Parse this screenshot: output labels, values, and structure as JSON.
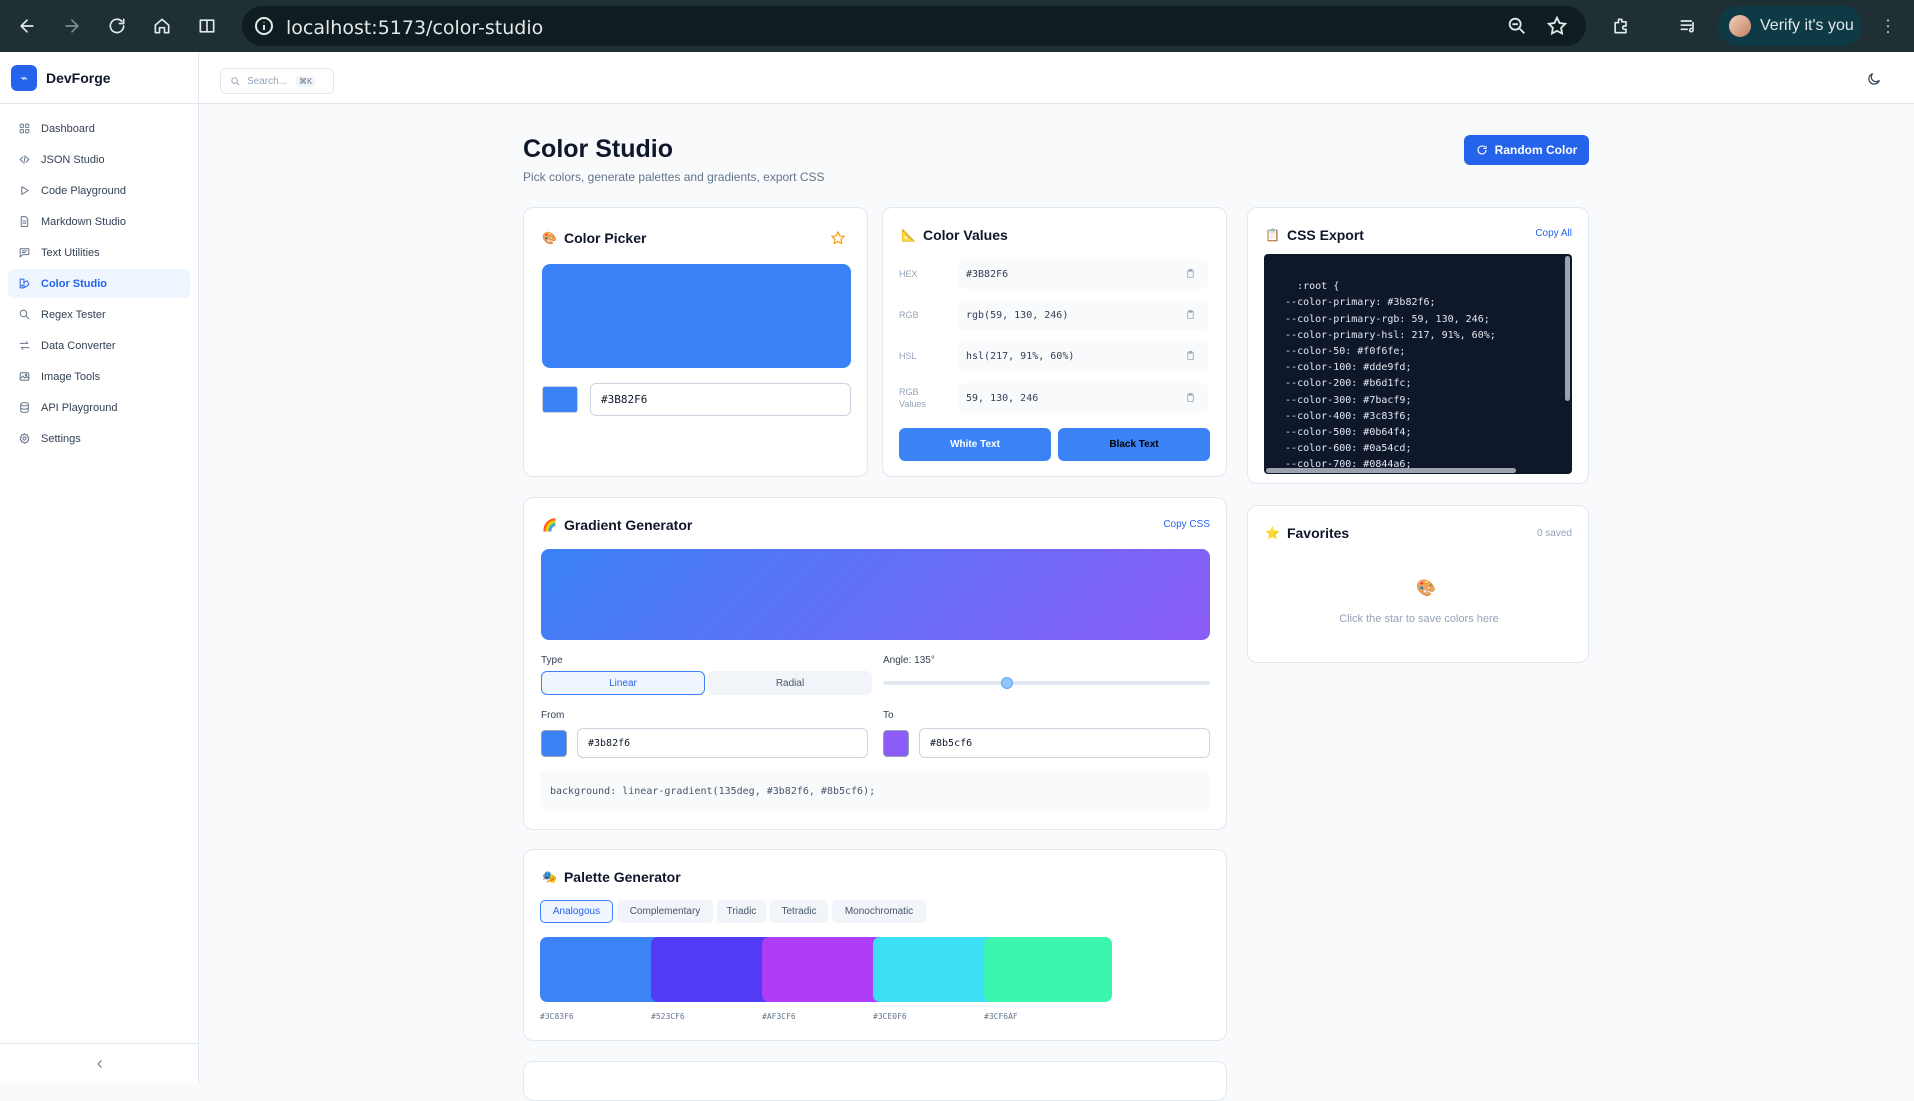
{
  "browser": {
    "url": "localhost:5173/color-studio",
    "profile_label": "Verify it's you"
  },
  "app": {
    "name": "DevForge",
    "search_placeholder": "Search...",
    "search_shortcut": "⌘K"
  },
  "sidebar": {
    "items": [
      {
        "label": "Dashboard",
        "icon": "grid-icon"
      },
      {
        "label": "JSON Studio",
        "icon": "code-icon"
      },
      {
        "label": "Code Playground",
        "icon": "play-icon"
      },
      {
        "label": "Markdown Studio",
        "icon": "document-icon"
      },
      {
        "label": "Text Utilities",
        "icon": "message-icon"
      },
      {
        "label": "Color Studio",
        "icon": "palette-icon",
        "active": true
      },
      {
        "label": "Regex Tester",
        "icon": "search-icon"
      },
      {
        "label": "Data Converter",
        "icon": "swap-icon"
      },
      {
        "label": "Image Tools",
        "icon": "image-icon"
      },
      {
        "label": "API Playground",
        "icon": "database-icon"
      },
      {
        "label": "Settings",
        "icon": "gear-icon"
      }
    ]
  },
  "header": {
    "title": "Color Studio",
    "subtitle": "Pick colors, generate palettes and gradients, export CSS",
    "random_button": "Random Color"
  },
  "picker": {
    "title": "Color Picker",
    "emoji": "🎨",
    "hex_value": "#3B82F6",
    "color": "#3b82f6"
  },
  "values": {
    "title": "Color Values",
    "emoji": "📐",
    "rows": [
      {
        "label": "HEX",
        "value": "#3B82F6"
      },
      {
        "label": "RGB",
        "value": "rgb(59, 130, 246)"
      },
      {
        "label": "HSL",
        "value": "hsl(217, 91%, 60%)"
      },
      {
        "label": "RGB Values",
        "value": "59, 130, 246"
      }
    ],
    "white_text_button": "White Text",
    "black_text_button": "Black Text"
  },
  "css_export": {
    "title": "CSS Export",
    "emoji": "📋",
    "copy_all": "Copy All",
    "code": ":root {\n  --color-primary: #3b82f6;\n  --color-primary-rgb: 59, 130, 246;\n  --color-primary-hsl: 217, 91%, 60%;\n  --color-50: #f0f6fe;\n  --color-100: #dde9fd;\n  --color-200: #b6d1fc;\n  --color-300: #7bacf9;\n  --color-400: #3c83f6;\n  --color-500: #0b64f4;\n  --color-600: #0a54cd;\n  --color-700: #0844a6;"
  },
  "gradient": {
    "title": "Gradient Generator",
    "emoji": "🌈",
    "copy_css": "Copy CSS",
    "type_label": "Type",
    "type_options": [
      "Linear",
      "Radial"
    ],
    "selected_type": "Linear",
    "angle_label": "Angle: 135°",
    "angle": 135,
    "from_label": "From",
    "to_label": "To",
    "from_value": "#3b82f6",
    "to_value": "#8b5cf6",
    "css": "background: linear-gradient(135deg, #3b82f6, #8b5cf6);"
  },
  "palette": {
    "title": "Palette Generator",
    "emoji": "🎭",
    "harmonies": [
      "Analogous",
      "Complementary",
      "Triadic",
      "Tetradic",
      "Monochromatic"
    ],
    "selected": "Analogous",
    "swatches": [
      {
        "hex": "#3C83F6",
        "color": "#3c83f6"
      },
      {
        "hex": "#523CF6",
        "color": "#523cf6"
      },
      {
        "hex": "#AF3CF6",
        "color": "#af3cf6"
      },
      {
        "hex": "#3CE0F6",
        "color": "#3ce0f6"
      },
      {
        "hex": "#3CF6AF",
        "color": "#3cf6af"
      }
    ]
  },
  "favorites": {
    "title": "Favorites",
    "emoji": "⭐",
    "count": "0 saved",
    "empty_icon": "🎨",
    "empty_text": "Click the star to save colors here"
  }
}
